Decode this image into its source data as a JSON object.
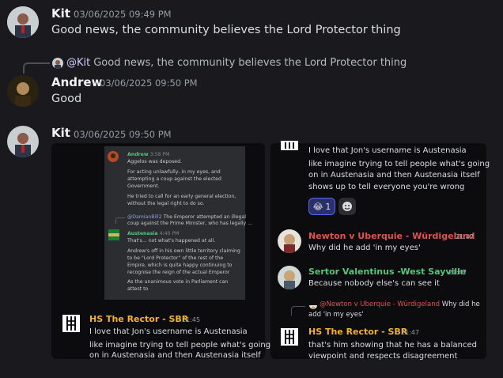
{
  "messages": [
    {
      "author": "Kit",
      "timestamp": "03/06/2025 09:49 PM",
      "text": "Good news, the community believes the Lord Protector thing"
    },
    {
      "author": "Andrew",
      "timestamp": "03/06/2025 09:50 PM",
      "text": "Good",
      "reply": {
        "mention": "@Kit",
        "text": "Good news, the community believes the Lord Protector thing"
      }
    },
    {
      "author": "Kit",
      "timestamp": "03/06/2025 09:50 PM"
    }
  ],
  "left_panel": {
    "screenshot": {
      "andrew_name": "Andrew",
      "andrew_ts": "3:58 PM",
      "andrew_lines": [
        "Aggelos was deposed.",
        "For acting unlawfully, in my eyes, and",
        "attempting a coup against the elected",
        "Government.",
        "He tried to call for an early general election,",
        "without the legal right to do so."
      ],
      "reply_mention": "@DamianBill2",
      "reply_text": "The Emperor attempted an illegal",
      "reply_text2": "coup against the Prime Minister, who has legally ...",
      "austenasia_name": "Austenasia",
      "austenasia_ts": "4:40 PM",
      "austenasia_lines": [
        "That's... not what's happened at all.",
        "Andrew's off in his own little territory claiming",
        "to be \"Lord Protector\" of the rest of the",
        "Empire, which is quite happy continuing to",
        "recognise the reign of the actual Emperor",
        "As the unanimous vote in Parliament can",
        "attest to"
      ]
    },
    "poster_name": "HS The Rector - SBR",
    "poster_ts": "21:45",
    "lines": [
      "I love that Jon's username is Austenasia",
      "like imagine trying to tell people what's going",
      "on in Austenasia and then Austenasia itself"
    ]
  },
  "right_panel": {
    "top_lines": [
      "I love that Jon's username is Austenasia",
      "like imagine trying to tell people what's going",
      "on in Austenasia and then Austenasia itself",
      "shows up to tell everyone you're wrong"
    ],
    "reaction_count": "1",
    "posts": [
      {
        "name": "Newton v Uberquie - Würdigeland",
        "ts": "21:47",
        "text": "Why did he add 'in my eyes'",
        "color": "#e05252"
      },
      {
        "name": "Sertor Valentinus -West Sayville",
        "ts": "21:47",
        "text": "Because nobody else's can see it",
        "color": "#57c47a"
      }
    ],
    "reply_mention": "@Newton v Uberquie - Würdigeland",
    "reply_text": "Why did he",
    "reply_text2": "add 'in my eyes'",
    "last_name": "HS The Rector - SBR",
    "last_ts": "21:47",
    "last_lines": [
      "that's him showing that he has a balanced",
      "viewpoint and respects disagreement"
    ]
  }
}
